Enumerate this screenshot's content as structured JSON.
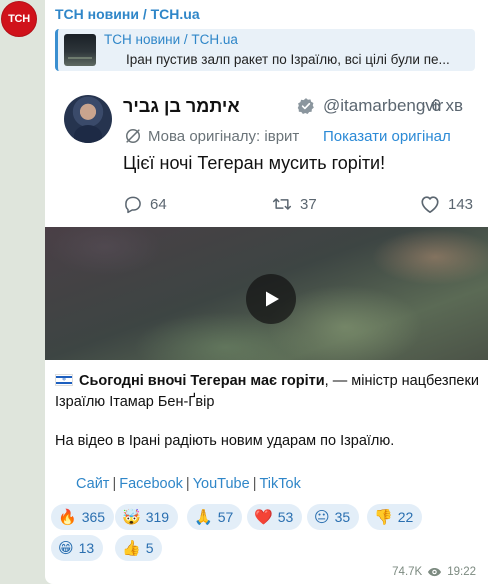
{
  "channel": {
    "avatar_text": "ТСН",
    "name": "ТСН новини / TCH.ua"
  },
  "reply": {
    "title": "ТСН новини / TCH.ua",
    "text": "Іран пустив залп ракет по Ізраїлю, всі цілі були пе..."
  },
  "tweet": {
    "name": "איתמר בן גביר",
    "handle": "@itamarbengvir",
    "time": "· 6 хв",
    "translation_note": "Мова оригіналу: іврит",
    "translation_link": "Показати оригінал",
    "body": "Цієї ночі Тегеран мусить горіти!",
    "replies": "64",
    "retweets": "37",
    "likes": "143"
  },
  "video": {
    "play_icon": "play-icon"
  },
  "message": {
    "bold_text": "Сьогодні вночі Тегеран має горіти",
    "rest_text": ", — міністр нацбезпеки Ізраїлю Ітамар Бен-Ґвір",
    "paragraph2": "На відео в Ірані радіють новим ударам по Ізраїлю."
  },
  "links": {
    "site": "Сайт",
    "facebook": "Facebook",
    "youtube": "YouTube",
    "tiktok": "TikTok",
    "separator": "|"
  },
  "reactions": [
    {
      "emoji": "🔥",
      "count": "365"
    },
    {
      "emoji": "🤯",
      "count": "319"
    },
    {
      "emoji": "🙏",
      "count": "57"
    },
    {
      "emoji": "❤️",
      "count": "53"
    },
    {
      "emoji": "😐",
      "count": "35"
    },
    {
      "emoji": "👎",
      "count": "22"
    },
    {
      "emoji": "😁",
      "count": "13"
    },
    {
      "emoji": "👍",
      "count": "5"
    }
  ],
  "meta": {
    "views": "74.7K",
    "time": "19:22"
  },
  "colors": {
    "accent": "#2f86c8",
    "avatar_red": "#d0121b",
    "reaction_bg": "#e3eef8"
  }
}
